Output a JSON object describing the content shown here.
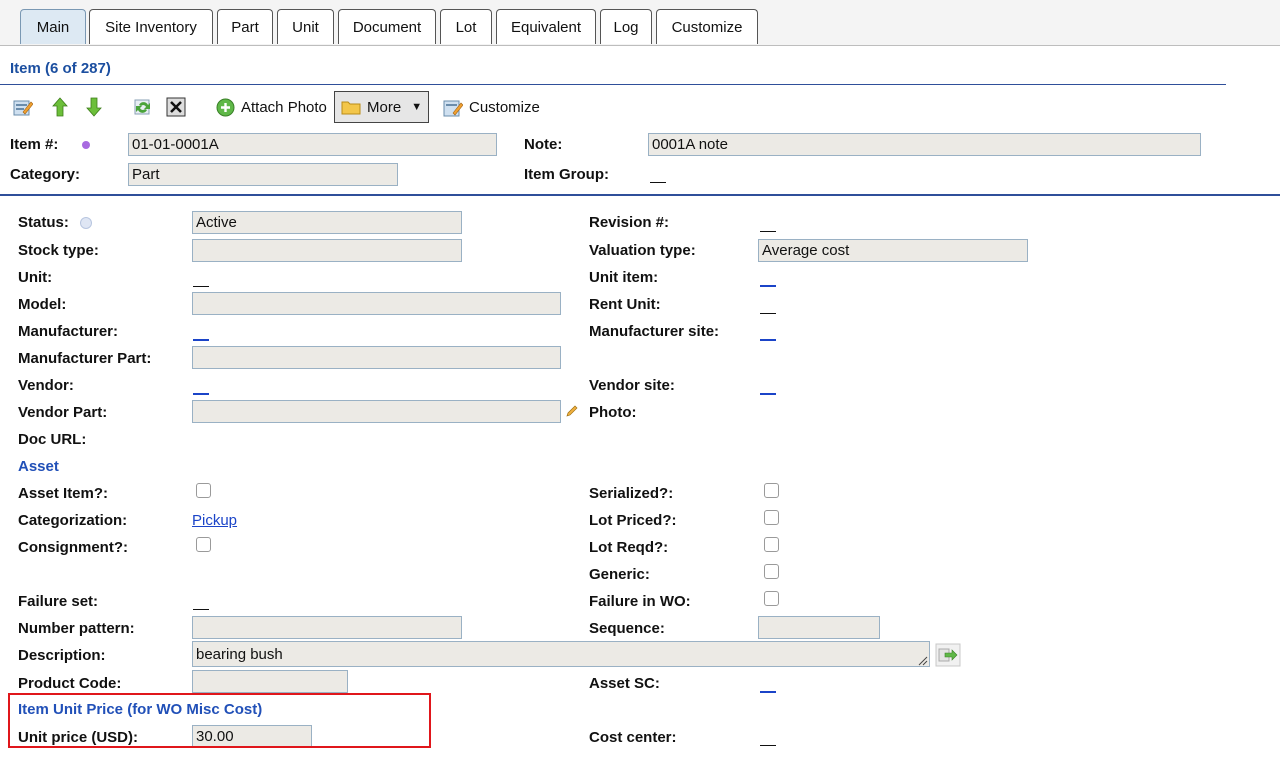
{
  "tabs": [
    "Main",
    "Site Inventory",
    "Part",
    "Unit",
    "Document",
    "Lot",
    "Equivalent",
    "Log",
    "Customize"
  ],
  "title": "Item (6 of 287)",
  "toolbar": {
    "attach_photo": "Attach Photo",
    "more": "More",
    "customize": "Customize"
  },
  "header": {
    "item_no_label": "Item #:",
    "item_no_value": "01-01-0001A",
    "note_label": "Note:",
    "note_value": "0001A note",
    "category_label": "Category:",
    "category_value": "Part",
    "item_group_label": "Item Group:"
  },
  "fields": {
    "status_label": "Status:",
    "status_value": "Active",
    "stock_type_label": "Stock type:",
    "unit_label": "Unit:",
    "model_label": "Model:",
    "manufacturer_label": "Manufacturer:",
    "manufacturer_part_label": "Manufacturer Part:",
    "vendor_label": "Vendor:",
    "vendor_part_label": "Vendor Part:",
    "doc_url_label": "Doc URL:",
    "revision_label": "Revision #:",
    "valuation_type_label": "Valuation type:",
    "valuation_type_value": "Average cost",
    "unit_item_label": "Unit item:",
    "rent_unit_label": "Rent Unit:",
    "manufacturer_site_label": "Manufacturer site:",
    "vendor_site_label": "Vendor site:",
    "photo_label": "Photo:"
  },
  "asset": {
    "section_title": "Asset",
    "asset_item_label": "Asset Item?:",
    "categorization_label": "Categorization:",
    "categorization_value": "Pickup",
    "consignment_label": "Consignment?:",
    "serialized_label": "Serialized?:",
    "lot_priced_label": "Lot Priced?:",
    "lot_reqd_label": "Lot Reqd?:",
    "generic_label": "Generic:",
    "failure_set_label": "Failure set:",
    "failure_in_wo_label": "Failure in WO:",
    "number_pattern_label": "Number pattern:",
    "sequence_label": "Sequence:",
    "description_label": "Description:",
    "description_value": "bearing bush",
    "product_code_label": "Product Code:",
    "asset_sc_label": "Asset SC:"
  },
  "price": {
    "section_title": "Item Unit Price (for WO Misc Cost)",
    "unit_price_label": "Unit price (USD):",
    "unit_price_value": "30.00",
    "cost_center_label": "Cost center:"
  },
  "colors": {
    "accent_blue": "#2150b8",
    "highlight_red": "#e0161b",
    "field_bg": "#eceae5"
  }
}
